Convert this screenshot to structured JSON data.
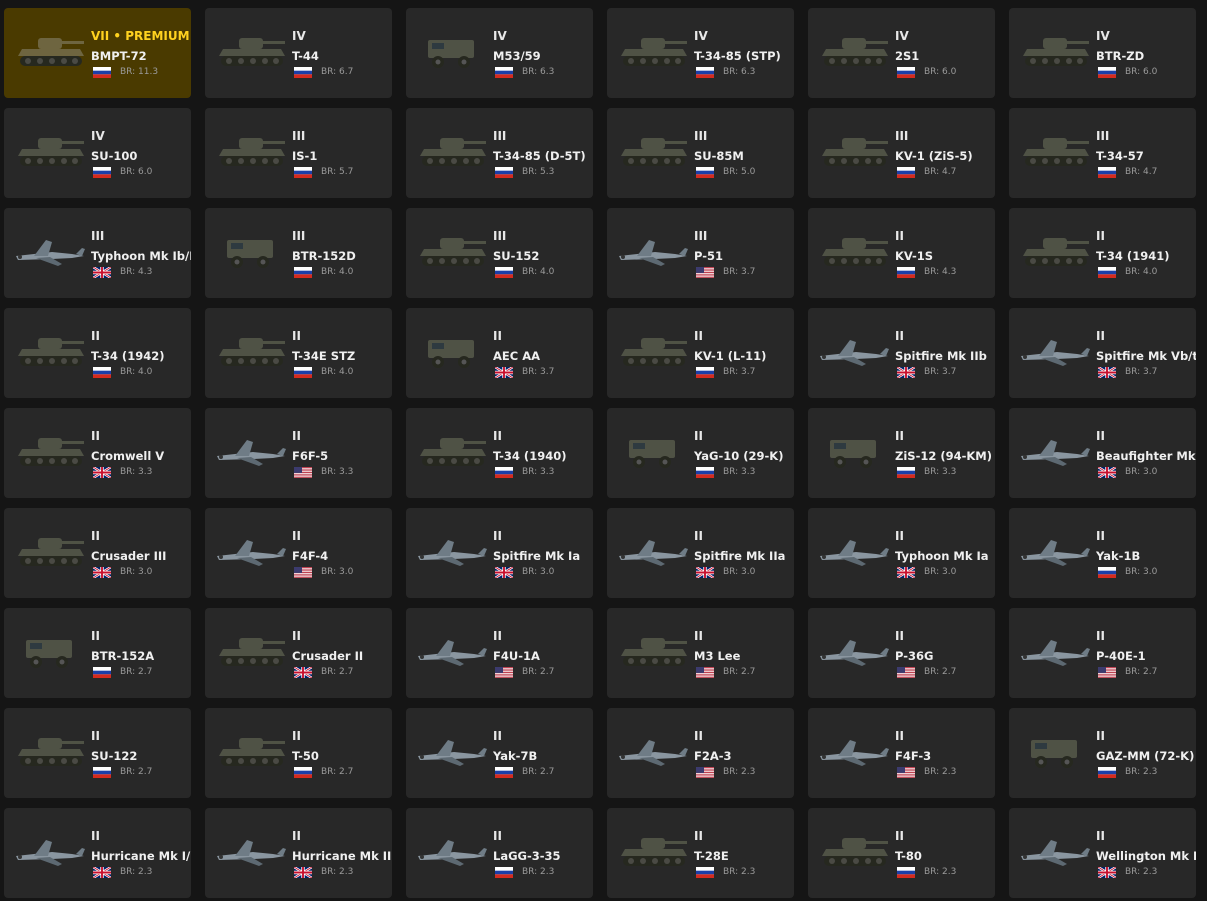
{
  "br_prefix": "BR:",
  "colors": {
    "card": "#282828",
    "premium_card": "#4a3a00",
    "premium_text": "#ffd21f"
  },
  "vehicles": [
    {
      "tier": "VII • PREMIUM",
      "name": "BMPT-72",
      "br": "11.3",
      "nation": "ussr",
      "kind": "tank",
      "premium": true
    },
    {
      "tier": "IV",
      "name": "T-44",
      "br": "6.7",
      "nation": "ussr",
      "kind": "tank"
    },
    {
      "tier": "IV",
      "name": "M53/59",
      "br": "6.3",
      "nation": "ussr",
      "kind": "truck"
    },
    {
      "tier": "IV",
      "name": "T-34-85 (STP)",
      "br": "6.3",
      "nation": "ussr",
      "kind": "tank"
    },
    {
      "tier": "IV",
      "name": "2S1",
      "br": "6.0",
      "nation": "ussr",
      "kind": "tank"
    },
    {
      "tier": "IV",
      "name": "BTR-ZD",
      "br": "6.0",
      "nation": "ussr",
      "kind": "tank"
    },
    {
      "tier": "IV",
      "name": "SU-100",
      "br": "6.0",
      "nation": "ussr",
      "kind": "tank"
    },
    {
      "tier": "III",
      "name": "IS-1",
      "br": "5.7",
      "nation": "ussr",
      "kind": "tank"
    },
    {
      "tier": "III",
      "name": "T-34-85 (D-5T)",
      "br": "5.3",
      "nation": "ussr",
      "kind": "tank"
    },
    {
      "tier": "III",
      "name": "SU-85M",
      "br": "5.0",
      "nation": "ussr",
      "kind": "tank"
    },
    {
      "tier": "III",
      "name": "KV-1 (ZiS-5)",
      "br": "4.7",
      "nation": "ussr",
      "kind": "tank"
    },
    {
      "tier": "III",
      "name": "T-34-57",
      "br": "4.7",
      "nation": "ussr",
      "kind": "tank"
    },
    {
      "tier": "III",
      "name": "Typhoon Mk Ib/L",
      "br": "4.3",
      "nation": "uk",
      "kind": "plane"
    },
    {
      "tier": "III",
      "name": "BTR-152D",
      "br": "4.0",
      "nation": "ussr",
      "kind": "truck"
    },
    {
      "tier": "III",
      "name": "SU-152",
      "br": "4.0",
      "nation": "ussr",
      "kind": "tank"
    },
    {
      "tier": "III",
      "name": "P-51",
      "br": "3.7",
      "nation": "usa",
      "kind": "plane"
    },
    {
      "tier": "II",
      "name": "KV-1S",
      "br": "4.3",
      "nation": "ussr",
      "kind": "tank"
    },
    {
      "tier": "II",
      "name": "T-34 (1941)",
      "br": "4.0",
      "nation": "ussr",
      "kind": "tank"
    },
    {
      "tier": "II",
      "name": "T-34 (1942)",
      "br": "4.0",
      "nation": "ussr",
      "kind": "tank"
    },
    {
      "tier": "II",
      "name": "T-34E STZ",
      "br": "4.0",
      "nation": "ussr",
      "kind": "tank"
    },
    {
      "tier": "II",
      "name": "AEC AA",
      "br": "3.7",
      "nation": "uk",
      "kind": "truck"
    },
    {
      "tier": "II",
      "name": "KV-1 (L-11)",
      "br": "3.7",
      "nation": "ussr",
      "kind": "tank"
    },
    {
      "tier": "II",
      "name": "Spitfire Mk IIb",
      "br": "3.7",
      "nation": "uk",
      "kind": "plane"
    },
    {
      "tier": "II",
      "name": "Spitfire Mk Vb/tro",
      "br": "3.7",
      "nation": "uk",
      "kind": "plane"
    },
    {
      "tier": "II",
      "name": "Cromwell V",
      "br": "3.3",
      "nation": "uk",
      "kind": "tank"
    },
    {
      "tier": "II",
      "name": "F6F-5",
      "br": "3.3",
      "nation": "usa",
      "kind": "plane"
    },
    {
      "tier": "II",
      "name": "T-34 (1940)",
      "br": "3.3",
      "nation": "ussr",
      "kind": "tank"
    },
    {
      "tier": "II",
      "name": "YaG-10 (29-K)",
      "br": "3.3",
      "nation": "ussr",
      "kind": "truck"
    },
    {
      "tier": "II",
      "name": "ZiS-12 (94-KM)",
      "br": "3.3",
      "nation": "ussr",
      "kind": "truck"
    },
    {
      "tier": "II",
      "name": "Beaufighter Mk VI",
      "br": "3.0",
      "nation": "uk",
      "kind": "plane"
    },
    {
      "tier": "II",
      "name": "Crusader III",
      "br": "3.0",
      "nation": "uk",
      "kind": "tank"
    },
    {
      "tier": "II",
      "name": "F4F-4",
      "br": "3.0",
      "nation": "usa",
      "kind": "plane"
    },
    {
      "tier": "II",
      "name": "Spitfire Mk Ia",
      "br": "3.0",
      "nation": "uk",
      "kind": "plane"
    },
    {
      "tier": "II",
      "name": "Spitfire Mk IIa",
      "br": "3.0",
      "nation": "uk",
      "kind": "plane"
    },
    {
      "tier": "II",
      "name": "Typhoon Mk Ia",
      "br": "3.0",
      "nation": "uk",
      "kind": "plane"
    },
    {
      "tier": "II",
      "name": "Yak-1B",
      "br": "3.0",
      "nation": "ussr",
      "kind": "plane"
    },
    {
      "tier": "II",
      "name": "BTR-152A",
      "br": "2.7",
      "nation": "ussr",
      "kind": "truck"
    },
    {
      "tier": "II",
      "name": "Crusader II",
      "br": "2.7",
      "nation": "uk",
      "kind": "tank"
    },
    {
      "tier": "II",
      "name": "F4U-1A",
      "br": "2.7",
      "nation": "usa",
      "kind": "plane"
    },
    {
      "tier": "II",
      "name": "M3 Lee",
      "br": "2.7",
      "nation": "usa",
      "kind": "tank"
    },
    {
      "tier": "II",
      "name": "P-36G",
      "br": "2.7",
      "nation": "usa",
      "kind": "plane"
    },
    {
      "tier": "II",
      "name": "P-40E-1",
      "br": "2.7",
      "nation": "usa",
      "kind": "plane"
    },
    {
      "tier": "II",
      "name": "SU-122",
      "br": "2.7",
      "nation": "ussr",
      "kind": "tank"
    },
    {
      "tier": "II",
      "name": "T-50",
      "br": "2.7",
      "nation": "ussr",
      "kind": "tank"
    },
    {
      "tier": "II",
      "name": "Yak-7B",
      "br": "2.7",
      "nation": "ussr",
      "kind": "plane"
    },
    {
      "tier": "II",
      "name": "F2A-3",
      "br": "2.3",
      "nation": "usa",
      "kind": "plane"
    },
    {
      "tier": "II",
      "name": "F4F-3",
      "br": "2.3",
      "nation": "usa",
      "kind": "plane"
    },
    {
      "tier": "II",
      "name": "GAZ-MM (72-K)",
      "br": "2.3",
      "nation": "ussr",
      "kind": "truck"
    },
    {
      "tier": "II",
      "name": "Hurricane Mk I/L",
      "br": "2.3",
      "nation": "uk",
      "kind": "plane"
    },
    {
      "tier": "II",
      "name": "Hurricane Mk IIB/Trop",
      "br": "2.3",
      "nation": "uk",
      "kind": "plane"
    },
    {
      "tier": "II",
      "name": "LaGG-3-35",
      "br": "2.3",
      "nation": "ussr",
      "kind": "plane"
    },
    {
      "tier": "II",
      "name": "T-28E",
      "br": "2.3",
      "nation": "ussr",
      "kind": "tank"
    },
    {
      "tier": "II",
      "name": "T-80",
      "br": "2.3",
      "nation": "ussr",
      "kind": "tank"
    },
    {
      "tier": "II",
      "name": "Wellington Mk Ic",
      "br": "2.3",
      "nation": "uk",
      "kind": "plane"
    }
  ]
}
